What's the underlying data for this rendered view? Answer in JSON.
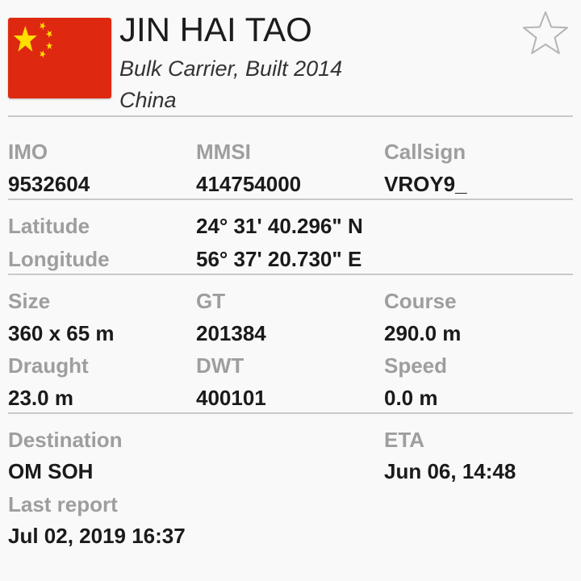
{
  "vessel": {
    "name": "JIN HAI TAO",
    "type_built": "Bulk Carrier, Built 2014",
    "country": "China"
  },
  "icons": {
    "flag": "china-flag-icon",
    "favorite": "star-outline-icon"
  },
  "colors": {
    "flag_red": "#de2910",
    "flag_yellow": "#ffde00",
    "label_gray": "#9e9e9e",
    "value_dark": "#1a1a1a"
  },
  "ids": {
    "imo_label": "IMO",
    "imo_value": "9532604",
    "mmsi_label": "MMSI",
    "mmsi_value": "414754000",
    "callsign_label": "Callsign",
    "callsign_value": "VROY9_"
  },
  "position": {
    "latitude_label": "Latitude",
    "latitude_value": "24° 31' 40.296\" N",
    "longitude_label": "Longitude",
    "longitude_value": "56° 37' 20.730\" E"
  },
  "dimensions": {
    "size_label": "Size",
    "size_value": "360 x 65 m",
    "gt_label": "GT",
    "gt_value": "201384",
    "course_label": "Course",
    "course_value": "290.0 m",
    "draught_label": "Draught",
    "draught_value": "23.0 m",
    "dwt_label": "DWT",
    "dwt_value": "400101",
    "speed_label": "Speed",
    "speed_value": "0.0 m"
  },
  "voyage": {
    "destination_label": "Destination",
    "destination_value": "OM SOH",
    "eta_label": "ETA",
    "eta_value": "Jun 06, 14:48",
    "last_report_label": "Last report",
    "last_report_value": "Jul 02, 2019 16:37"
  }
}
